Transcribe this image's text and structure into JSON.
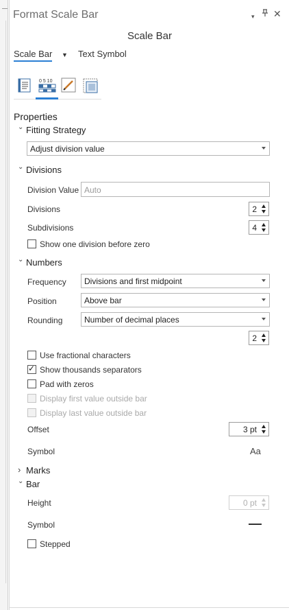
{
  "pane": {
    "title": "Format Scale Bar",
    "subtitle": "Scale Bar",
    "controls": {
      "menu": "▾",
      "pin": "⊿",
      "close": "✕"
    }
  },
  "tabs": [
    {
      "label": "Scale Bar",
      "active": true
    },
    {
      "label": "Text Symbol",
      "active": false
    }
  ],
  "tab_dropdown_glyph": "▼",
  "icon_tabs": [
    {
      "name": "options-icon",
      "active": false
    },
    {
      "name": "scale-bar-properties-icon",
      "active": true,
      "text": "0 5 10"
    },
    {
      "name": "symbol-pencil-icon",
      "active": false
    },
    {
      "name": "display-icon",
      "active": false
    }
  ],
  "properties_label": "Properties",
  "fitting_strategy": {
    "label": "Fitting Strategy",
    "value": "Adjust division value"
  },
  "divisions": {
    "label": "Divisions",
    "division_value_label": "Division Value",
    "division_value_placeholder": "Auto",
    "divisions_label": "Divisions",
    "divisions_value": "2",
    "subdivisions_label": "Subdivisions",
    "subdivisions_value": "4",
    "show_one_before_zero_label": "Show one division before zero",
    "show_one_before_zero_checked": false
  },
  "numbers": {
    "label": "Numbers",
    "frequency_label": "Frequency",
    "frequency_value": "Divisions and first midpoint",
    "position_label": "Position",
    "position_value": "Above bar",
    "rounding_label": "Rounding",
    "rounding_value": "Number of decimal places",
    "decimal_places_value": "2",
    "use_fractional_label": "Use fractional characters",
    "show_thousands_label": "Show thousands separators",
    "pad_zeros_label": "Pad with zeros",
    "display_first_label": "Display first value outside bar",
    "display_last_label": "Display last value outside bar",
    "offset_label": "Offset",
    "offset_value": "3 pt",
    "symbol_label": "Symbol",
    "symbol_preview": "Aa"
  },
  "marks": {
    "label": "Marks"
  },
  "bar": {
    "label": "Bar",
    "height_label": "Height",
    "height_value": "0 pt",
    "symbol_label": "Symbol",
    "stepped_label": "Stepped"
  },
  "glyphs": {
    "expanded": "⌄",
    "collapsed": "›",
    "check": "✓"
  },
  "colors": {
    "accent": "#2a7fd4"
  }
}
